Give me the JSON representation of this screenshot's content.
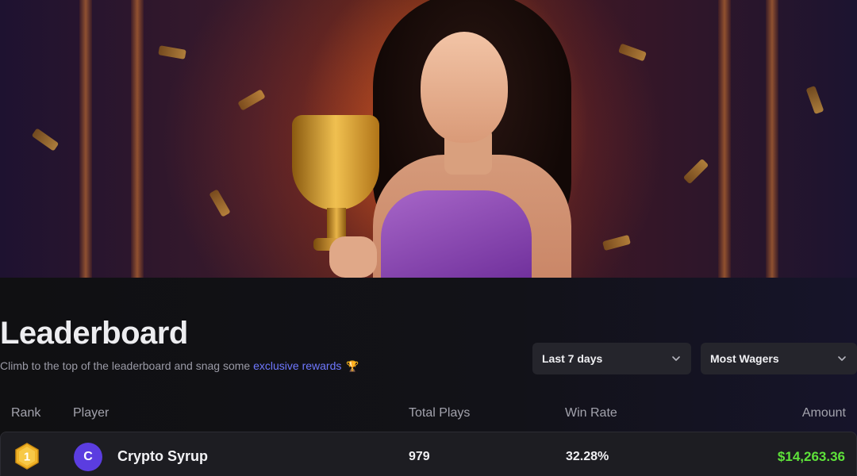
{
  "hero": {
    "image": "woman-holding-trophy-banner"
  },
  "header": {
    "title": "Leaderboard",
    "subtitle_prefix": "Climb to the top of the leaderboard and snag some ",
    "subtitle_link": "exclusive rewards",
    "subtitle_icon": "trophy-icon"
  },
  "filters": {
    "period": "Last 7 days",
    "sort": "Most Wagers"
  },
  "table": {
    "columns": [
      "Rank",
      "Player",
      "Total Plays",
      "Win Rate",
      "Amount"
    ],
    "rows": [
      {
        "rank": "1",
        "avatar_letter": "C",
        "player": "Crypto Syrup",
        "total_plays": "979",
        "win_rate": "32.28%",
        "amount": "$14,263.36"
      }
    ]
  },
  "colors": {
    "accent_link": "#6f78ff",
    "amount_positive": "#5ee23a",
    "avatar": "#5b3de0",
    "rank_gold": "#f0b429"
  }
}
